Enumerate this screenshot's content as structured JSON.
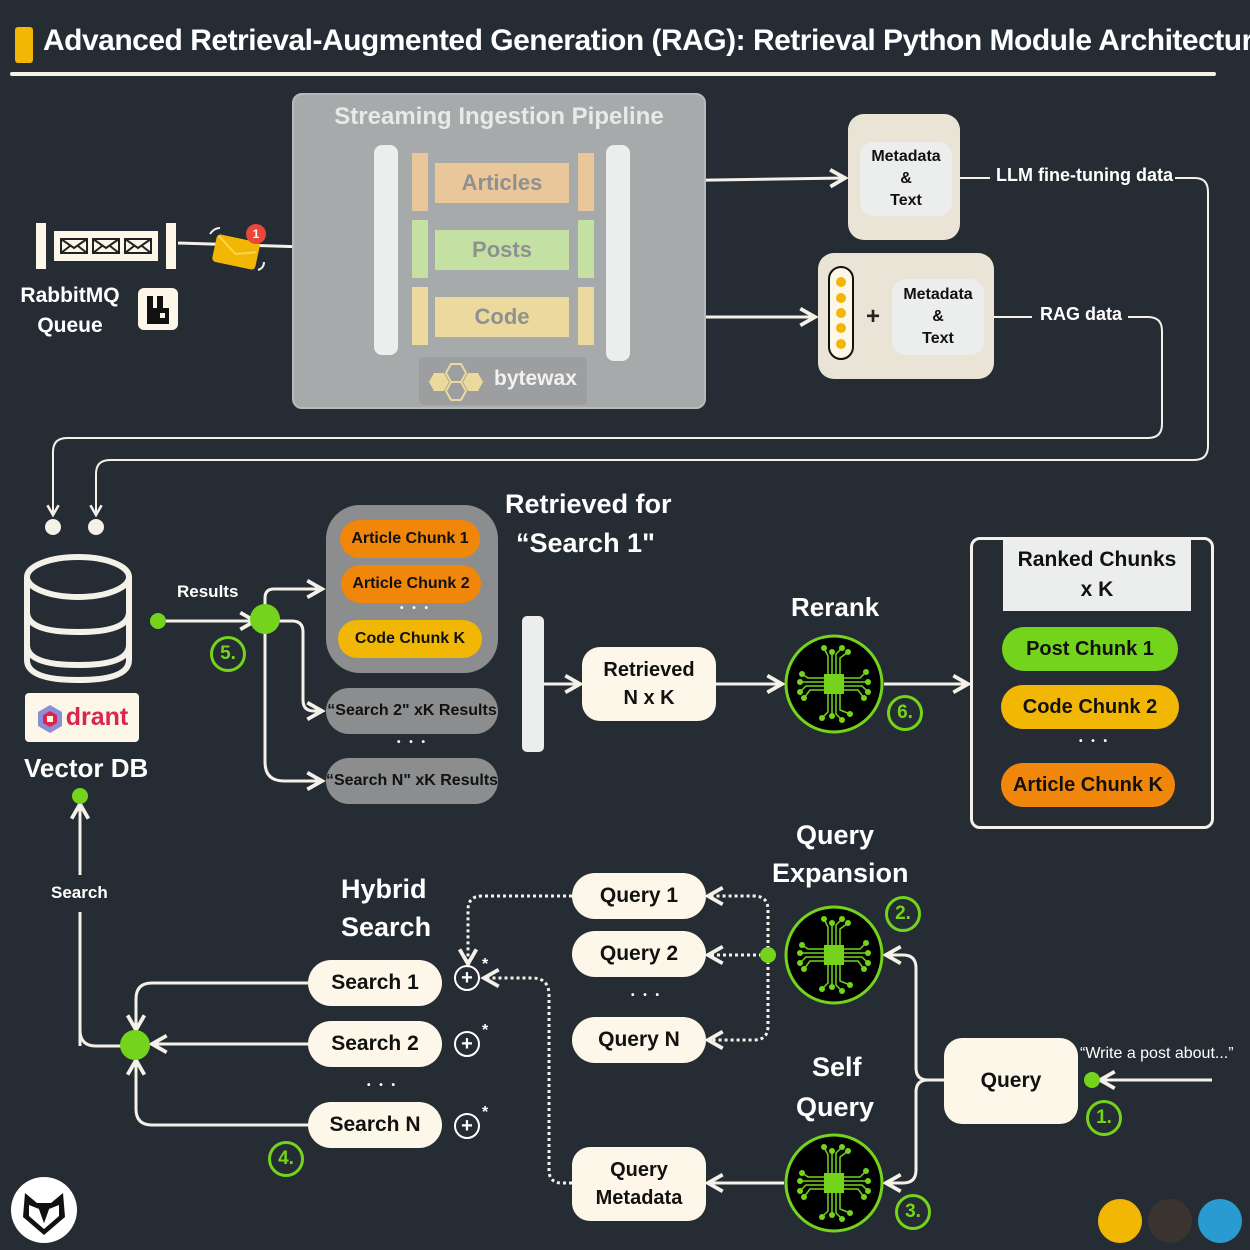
{
  "title": "Advanced Retrieval-Augmented Generation (RAG): Retrieval Python Module Architecture",
  "colors": {
    "background": "#262c34",
    "accent_yellow": "#f2b705",
    "accent_green": "#74d41c",
    "chunk_orange": "#f0870b",
    "cream": "#fcf7e8"
  },
  "queue": {
    "label_line1": "RabbitMQ",
    "label_line2": "Queue",
    "notification_count": "1",
    "icons": [
      "envelope-icon",
      "envelope-icon",
      "envelope-icon",
      "rabbitmq-logo-icon",
      "mail-notification-icon"
    ]
  },
  "pipeline": {
    "title": "Streaming Ingestion Pipeline",
    "streams": [
      "Articles",
      "Posts",
      "Code"
    ],
    "engine": "bytewax"
  },
  "outputs": {
    "finetune_card": {
      "line1": "Metadata",
      "line2": "&",
      "line3": "Text"
    },
    "finetune_label": "LLM fine-tuning data",
    "rag_card": {
      "plus": "+",
      "line1": "Metadata",
      "line2": "&",
      "line3": "Text"
    },
    "rag_label": "RAG data"
  },
  "vector_db": {
    "logo_text": "drant",
    "label": "Vector DB",
    "results_label": "Results",
    "search_label": "Search"
  },
  "retrieved": {
    "title_line1": "Retrieved for",
    "title_line2": "“Search 1\"",
    "chunks": [
      "Article Chunk 1",
      "Article Chunk 2",
      "Code Chunk K"
    ],
    "ellipsis": "• • •",
    "other_results": [
      "“Search 2\" xK Results",
      "“Search N\" xK Results"
    ],
    "merged_line1": "Retrieved",
    "merged_line2": "N x K"
  },
  "rerank": {
    "label": "Rerank",
    "ranked_title_line1": "Ranked Chunks",
    "ranked_title_line2": "x K",
    "ranked": [
      "Post Chunk 1",
      "Code Chunk 2",
      "Article Chunk K"
    ],
    "ellipsis": "• • •"
  },
  "hybrid": {
    "title_line1": "Hybrid",
    "title_line2": "Search",
    "searches": [
      "Search 1",
      "Search 2",
      "Search N"
    ],
    "ellipsis": "• • •",
    "plus": "+",
    "star": "*"
  },
  "expansion": {
    "title_line1": "Query",
    "title_line2": "Expansion",
    "queries": [
      "Query 1",
      "Query 2",
      "Query N"
    ],
    "ellipsis": "• • •"
  },
  "self_query": {
    "title_line1": "Self",
    "title_line2": "Query",
    "metadata_line1": "Query",
    "metadata_line2": "Metadata"
  },
  "input": {
    "query_label": "Query",
    "prompt": "“Write a post about...”"
  },
  "steps": [
    "1.",
    "2.",
    "3.",
    "4.",
    "5.",
    "6."
  ]
}
